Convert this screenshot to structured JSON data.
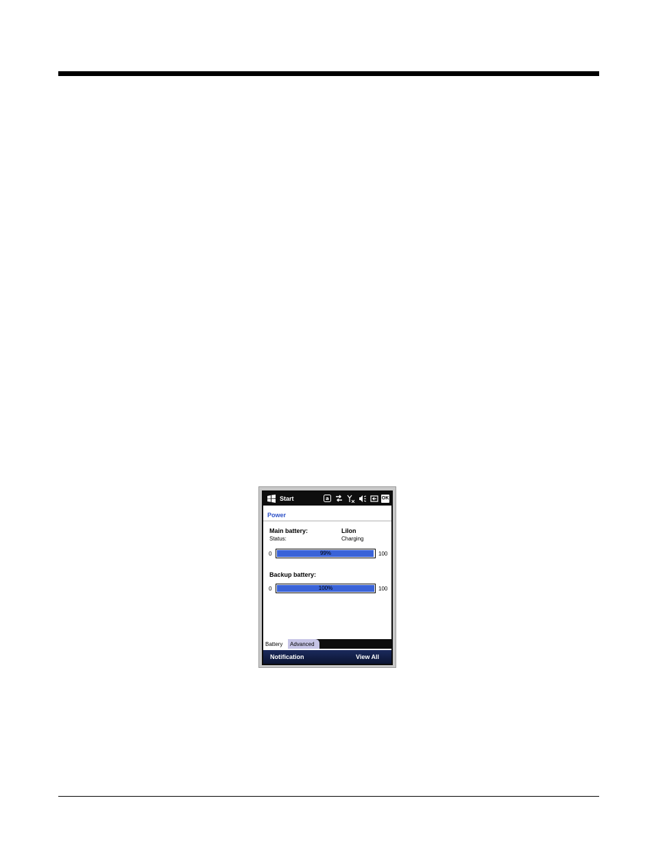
{
  "statusbar": {
    "start_label": "Start",
    "icons": [
      "email-icon",
      "data-sync-icon",
      "no-signal-icon",
      "speaker-muted-icon",
      "battery-charging-icon"
    ],
    "ok_label": "OK"
  },
  "page": {
    "title": "Power"
  },
  "main_battery": {
    "label": "Main battery:",
    "type": "LiIon",
    "status_label": "Status:",
    "status_value": "Charging",
    "scale_min": "0",
    "scale_max": "100",
    "level_percent": 99,
    "level_text": "99%"
  },
  "backup_battery": {
    "label": "Backup battery:",
    "scale_min": "0",
    "scale_max": "100",
    "level_percent": 100,
    "level_text": "100%"
  },
  "tabs": [
    {
      "label": "Battery",
      "selected": true
    },
    {
      "label": "Advanced",
      "selected": false
    }
  ],
  "softkeys": {
    "left": "Notification",
    "right": "View All"
  },
  "colors": {
    "accent": "#2d51c7",
    "progress_fill": "#3a63d8",
    "softkey_bar": "#1b2a5c"
  }
}
